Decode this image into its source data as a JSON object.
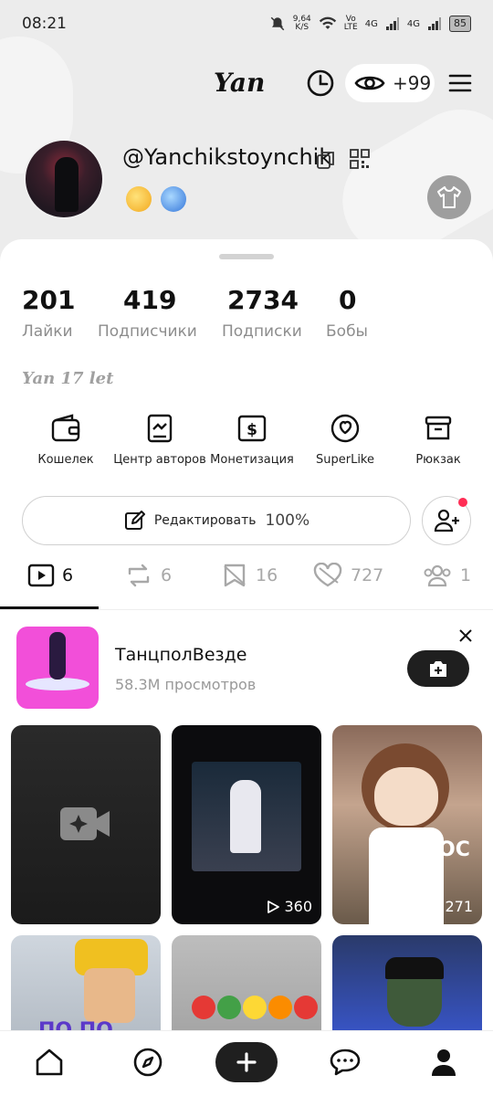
{
  "status_bar": {
    "time": "08:21",
    "net_speed_value": "9,64",
    "net_speed_unit": "K/S",
    "volte_1": "Vo",
    "volte_2": "LTE",
    "net1": "4G",
    "net2": "4G",
    "battery": "85"
  },
  "top_bar": {
    "logo": "Yan",
    "views_count": "+99"
  },
  "profile": {
    "username": "@Yanchikstoynchik",
    "bio": "Yan 17 let"
  },
  "stats": [
    {
      "value": "201",
      "label": "Лайки"
    },
    {
      "value": "419",
      "label": "Подписчики"
    },
    {
      "value": "2734",
      "label": "Подписки"
    },
    {
      "value": "0",
      "label": "Бобы"
    }
  ],
  "tools": [
    {
      "label": "Кошелек",
      "icon": "wallet-icon"
    },
    {
      "label": "Центр авторов",
      "icon": "creator-center-icon"
    },
    {
      "label": "Монетизация",
      "icon": "dollar-icon"
    },
    {
      "label": "SuperLike",
      "icon": "superlike-icon"
    },
    {
      "label": "Рюкзак",
      "icon": "backpack-icon"
    }
  ],
  "edit": {
    "label": "Редактировать",
    "percent": "100%"
  },
  "tabs": [
    {
      "icon": "video-play-icon",
      "count": "6"
    },
    {
      "icon": "repost-icon",
      "count": "6"
    },
    {
      "icon": "bookmark-icon",
      "count": "16"
    },
    {
      "icon": "liked-hidden-icon",
      "count": "727"
    },
    {
      "icon": "friends-icon",
      "count": "1"
    }
  ],
  "promo": {
    "title": "ТанцполВезде",
    "subtitle": "58.3M просмотров"
  },
  "videos": [
    {
      "views": ""
    },
    {
      "views": "360"
    },
    {
      "views": "271",
      "overlay_text": "OC"
    },
    {
      "views": "",
      "overlay_text": "ПО ПО"
    },
    {
      "views": ""
    },
    {
      "views": ""
    }
  ],
  "colors": {
    "accent_dot": "#ff2d55",
    "header_bg": "#ececec",
    "dark_button": "#1f1f1f"
  }
}
